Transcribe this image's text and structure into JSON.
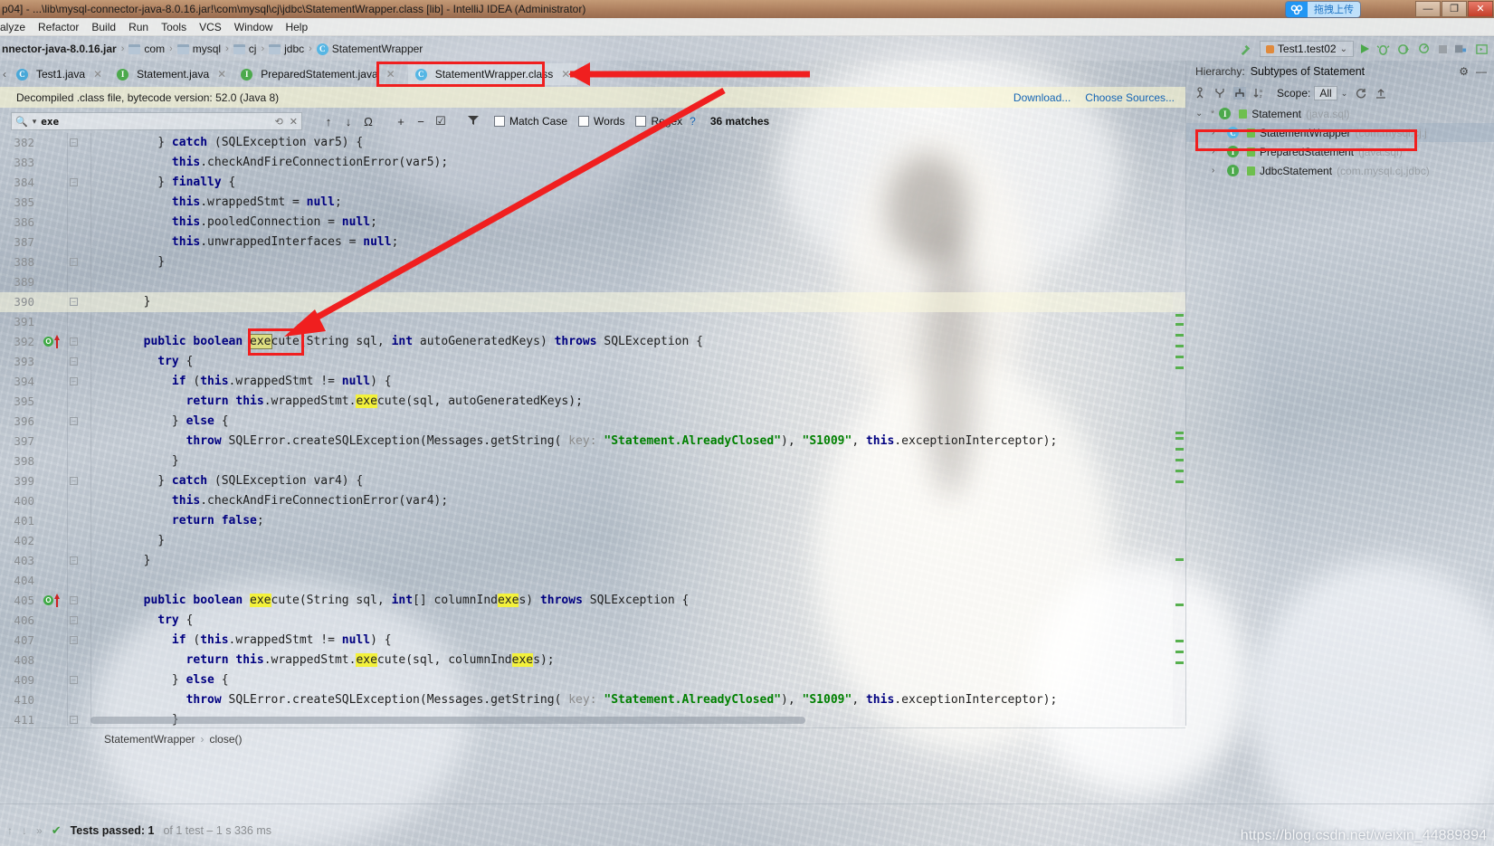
{
  "titlebar": {
    "text": "p04] - ...\\lib\\mysql-connector-java-8.0.16.jar!\\com\\mysql\\cj\\jdbc\\StatementWrapper.class [lib] - IntelliJ IDEA (Administrator)",
    "netdisk_label": "拖拽上传",
    "minimize": "—",
    "restore": "❐",
    "close": "✕"
  },
  "menubar": {
    "items": [
      "alyze",
      "Refactor",
      "Build",
      "Run",
      "Tools",
      "VCS",
      "Window",
      "Help"
    ]
  },
  "navbar": {
    "crumbs": [
      {
        "label": "nnector-java-8.0.16.jar",
        "icon": "jar-icon"
      },
      {
        "label": "com",
        "icon": "folder-icon"
      },
      {
        "label": "mysql",
        "icon": "folder-icon"
      },
      {
        "label": "cj",
        "icon": "folder-icon"
      },
      {
        "label": "jdbc",
        "icon": "folder-icon"
      },
      {
        "label": "StatementWrapper",
        "icon": "class-icon"
      }
    ],
    "separator": "›"
  },
  "runbar": {
    "config_name": "Test1.test02",
    "dropdown_caret": "⌄",
    "buttons": [
      "run-button",
      "debug-button",
      "run-with-coverage-button",
      "profile-button",
      "stop-button",
      "build-button",
      "more-button"
    ]
  },
  "tabs": [
    {
      "label": "Test1.java",
      "icon": "java-class-icon",
      "active": false,
      "close": "✕"
    },
    {
      "label": "Statement.java",
      "icon": "interface-icon",
      "active": false,
      "close": "✕"
    },
    {
      "label": "PreparedStatement.java",
      "icon": "interface-icon",
      "active": false,
      "close": "✕"
    },
    {
      "label": "StatementWrapper.class",
      "icon": "class-icon",
      "active": true,
      "close": "✕"
    }
  ],
  "notice": {
    "text": "Decompiled .class file, bytecode version: 52.0 (Java 8)",
    "download_link": "Download...",
    "choose_sources_link": "Choose Sources..."
  },
  "findbar": {
    "query_icon": "search-icon",
    "query": "exe",
    "history_caret": "▾",
    "reset_icon": "⟲",
    "clear_icon": "✕",
    "prev_icon": "↑",
    "next_icon": "↓",
    "loop_icon": "Ω",
    "add_line_icon": "+",
    "remove_line_icon": "−",
    "select_all_icon": "☑",
    "filter_icon": "filter-icon",
    "match_case": "Match Case",
    "match_case_checked": false,
    "words": "Words",
    "words_checked": false,
    "regex": "Regex",
    "regex_checked": false,
    "help": "?",
    "matches": "36 matches"
  },
  "editor": {
    "first_line": 382,
    "highlight_term": "exe",
    "lines": [
      {
        "n": 382,
        "fold": true,
        "indent": 10,
        "tokens": [
          {
            "t": "} ",
            "c": ""
          },
          {
            "t": "catch ",
            "c": "kw"
          },
          {
            "t": "(SQLException var5) {",
            "c": ""
          }
        ]
      },
      {
        "n": 383,
        "indent": 12,
        "tokens": [
          {
            "t": "this",
            "c": "kw"
          },
          {
            "t": ".checkAndFireConnectionError(var5);",
            "c": ""
          }
        ]
      },
      {
        "n": 384,
        "fold": true,
        "indent": 10,
        "tokens": [
          {
            "t": "} ",
            "c": ""
          },
          {
            "t": "finally",
            "c": "kw"
          },
          {
            "t": " {",
            "c": ""
          }
        ]
      },
      {
        "n": 385,
        "indent": 12,
        "tokens": [
          {
            "t": "this",
            "c": "kw"
          },
          {
            "t": ".wrappedStmt = ",
            "c": ""
          },
          {
            "t": "null",
            "c": "kw"
          },
          {
            "t": ";",
            "c": ""
          }
        ]
      },
      {
        "n": 386,
        "indent": 12,
        "tokens": [
          {
            "t": "this",
            "c": "kw"
          },
          {
            "t": ".pooledConnection = ",
            "c": ""
          },
          {
            "t": "null",
            "c": "kw"
          },
          {
            "t": ";",
            "c": ""
          }
        ]
      },
      {
        "n": 387,
        "indent": 12,
        "tokens": [
          {
            "t": "this",
            "c": "kw"
          },
          {
            "t": ".unwrappedInterfaces = ",
            "c": ""
          },
          {
            "t": "null",
            "c": "kw"
          },
          {
            "t": ";",
            "c": ""
          }
        ]
      },
      {
        "n": 388,
        "fold": true,
        "indent": 10,
        "tokens": [
          {
            "t": "}",
            "c": ""
          }
        ]
      },
      {
        "n": 389,
        "indent": 0,
        "tokens": []
      },
      {
        "n": 390,
        "fold": true,
        "current": true,
        "indent": 8,
        "tokens": [
          {
            "t": "}",
            "c": ""
          }
        ]
      },
      {
        "n": 391,
        "indent": 0,
        "tokens": []
      },
      {
        "n": 392,
        "fold": true,
        "gutter_mark": "overridden",
        "indent": 8,
        "tokens": [
          {
            "t": "public boolean ",
            "c": "kw"
          },
          {
            "t": "exe",
            "c": "hlbox"
          },
          {
            "t": "cute",
            "c": ""
          },
          {
            "t": "(String sql, ",
            "c": ""
          },
          {
            "t": "int",
            "c": "kw"
          },
          {
            "t": " autoGeneratedKeys) ",
            "c": ""
          },
          {
            "t": "throws",
            "c": "kw"
          },
          {
            "t": " SQLException {",
            "c": ""
          }
        ]
      },
      {
        "n": 393,
        "fold": true,
        "indent": 10,
        "tokens": [
          {
            "t": "try",
            "c": "kw"
          },
          {
            "t": " {",
            "c": ""
          }
        ]
      },
      {
        "n": 394,
        "fold": true,
        "indent": 12,
        "tokens": [
          {
            "t": "if",
            "c": "kw"
          },
          {
            "t": " (",
            "c": ""
          },
          {
            "t": "this",
            "c": "kw"
          },
          {
            "t": ".wrappedStmt != ",
            "c": ""
          },
          {
            "t": "null",
            "c": "kw"
          },
          {
            "t": ") {",
            "c": ""
          }
        ]
      },
      {
        "n": 395,
        "indent": 14,
        "tokens": [
          {
            "t": "return ",
            "c": "kw"
          },
          {
            "t": "this",
            "c": "kw"
          },
          {
            "t": ".wrappedStmt.",
            "c": ""
          },
          {
            "t": "exe",
            "c": "hl"
          },
          {
            "t": "cute(sql, autoGeneratedKeys);",
            "c": ""
          }
        ]
      },
      {
        "n": 396,
        "fold": true,
        "indent": 12,
        "tokens": [
          {
            "t": "} ",
            "c": ""
          },
          {
            "t": "else",
            "c": "kw"
          },
          {
            "t": " {",
            "c": ""
          }
        ]
      },
      {
        "n": 397,
        "indent": 14,
        "tokens": [
          {
            "t": "throw",
            "c": "kw"
          },
          {
            "t": " SQLError.createSQLException(Messages.getString(",
            "c": ""
          },
          {
            "t": " key:",
            "c": "hint"
          },
          {
            "t": " ",
            "c": ""
          },
          {
            "t": "\"Statement.AlreadyClosed\"",
            "c": "str"
          },
          {
            "t": "), ",
            "c": ""
          },
          {
            "t": "\"S1009\"",
            "c": "str"
          },
          {
            "t": ", ",
            "c": ""
          },
          {
            "t": "this",
            "c": "kw"
          },
          {
            "t": ".exceptionInterceptor);",
            "c": ""
          }
        ]
      },
      {
        "n": 398,
        "indent": 12,
        "tokens": [
          {
            "t": "}",
            "c": ""
          }
        ]
      },
      {
        "n": 399,
        "fold": true,
        "indent": 10,
        "tokens": [
          {
            "t": "} ",
            "c": ""
          },
          {
            "t": "catch",
            "c": "kw"
          },
          {
            "t": " (SQLException var4) {",
            "c": ""
          }
        ]
      },
      {
        "n": 400,
        "indent": 12,
        "tokens": [
          {
            "t": "this",
            "c": "kw"
          },
          {
            "t": ".checkAndFireConnectionError(var4);",
            "c": ""
          }
        ]
      },
      {
        "n": 401,
        "indent": 12,
        "tokens": [
          {
            "t": "return false",
            "c": "kw"
          },
          {
            "t": ";",
            "c": ""
          }
        ]
      },
      {
        "n": 402,
        "indent": 10,
        "tokens": [
          {
            "t": "}",
            "c": ""
          }
        ]
      },
      {
        "n": 403,
        "fold": true,
        "indent": 8,
        "tokens": [
          {
            "t": "}",
            "c": ""
          }
        ]
      },
      {
        "n": 404,
        "indent": 0,
        "tokens": []
      },
      {
        "n": 405,
        "fold": true,
        "gutter_mark": "overridden",
        "indent": 8,
        "tokens": [
          {
            "t": "public boolean ",
            "c": "kw"
          },
          {
            "t": "exe",
            "c": "hl"
          },
          {
            "t": "cute(String sql, ",
            "c": ""
          },
          {
            "t": "int",
            "c": "kw"
          },
          {
            "t": "[] columnInd",
            "c": ""
          },
          {
            "t": "exe",
            "c": "hl"
          },
          {
            "t": "s) ",
            "c": ""
          },
          {
            "t": "throws",
            "c": "kw"
          },
          {
            "t": " SQLException {",
            "c": ""
          }
        ]
      },
      {
        "n": 406,
        "fold": true,
        "indent": 10,
        "tokens": [
          {
            "t": "try",
            "c": "kw"
          },
          {
            "t": " {",
            "c": ""
          }
        ]
      },
      {
        "n": 407,
        "fold": true,
        "indent": 12,
        "tokens": [
          {
            "t": "if",
            "c": "kw"
          },
          {
            "t": " (",
            "c": ""
          },
          {
            "t": "this",
            "c": "kw"
          },
          {
            "t": ".wrappedStmt != ",
            "c": ""
          },
          {
            "t": "null",
            "c": "kw"
          },
          {
            "t": ") {",
            "c": ""
          }
        ]
      },
      {
        "n": 408,
        "indent": 14,
        "tokens": [
          {
            "t": "return ",
            "c": "kw"
          },
          {
            "t": "this",
            "c": "kw"
          },
          {
            "t": ".wrappedStmt.",
            "c": ""
          },
          {
            "t": "exe",
            "c": "hl"
          },
          {
            "t": "cute(sql, columnInd",
            "c": ""
          },
          {
            "t": "exe",
            "c": "hl"
          },
          {
            "t": "s);",
            "c": ""
          }
        ]
      },
      {
        "n": 409,
        "fold": true,
        "indent": 12,
        "tokens": [
          {
            "t": "} ",
            "c": ""
          },
          {
            "t": "else",
            "c": "kw"
          },
          {
            "t": " {",
            "c": ""
          }
        ]
      },
      {
        "n": 410,
        "indent": 14,
        "tokens": [
          {
            "t": "throw",
            "c": "kw"
          },
          {
            "t": " SQLError.createSQLException(Messages.getString(",
            "c": ""
          },
          {
            "t": " key:",
            "c": "hint"
          },
          {
            "t": " ",
            "c": ""
          },
          {
            "t": "\"Statement.AlreadyClosed\"",
            "c": "str"
          },
          {
            "t": "), ",
            "c": ""
          },
          {
            "t": "\"S1009\"",
            "c": "str"
          },
          {
            "t": ", ",
            "c": ""
          },
          {
            "t": "this",
            "c": "kw"
          },
          {
            "t": ".exceptionInterceptor);",
            "c": ""
          }
        ]
      },
      {
        "n": 411,
        "fold": true,
        "indent": 12,
        "tokens": [
          {
            "t": "}",
            "c": ""
          }
        ]
      }
    ]
  },
  "editor_breadcrumb": {
    "items": [
      "StatementWrapper",
      "close()"
    ],
    "separator": "›"
  },
  "hierarchy": {
    "title_prefix": "Hierarchy:",
    "title": "Subtypes of Statement",
    "settings_icon": "gear-icon",
    "hide_icon": "—",
    "toolbar": {
      "type_hierarchy_icon": "type-hierarchy-icon",
      "supertypes_icon": "supertypes-icon",
      "subtypes_icon": "subtypes-icon",
      "sort_icon": "sort-alpha-icon",
      "scope_label": "Scope:",
      "scope_value": "All",
      "scope_caret": "⌄",
      "refresh_icon": "refresh-icon",
      "export_icon": "export-icon"
    },
    "nodes": [
      {
        "depth": 0,
        "twisty": "⌄",
        "star": "*",
        "icon": "interface-icon",
        "name": "Statement",
        "pkg": "(java.sql)",
        "selected": false
      },
      {
        "depth": 1,
        "twisty": "›",
        "icon": "class-icon",
        "name": "StatementWrapper",
        "pkg": "(com.mysql.cj.j",
        "selected": true
      },
      {
        "depth": 1,
        "twisty": "›",
        "icon": "interface-icon",
        "name": "PreparedStatement",
        "pkg": "(java.sql)",
        "selected": false
      },
      {
        "depth": 1,
        "twisty": "›",
        "icon": "interface-icon",
        "name": "JdbcStatement",
        "pkg": "(com.mysql.cj.jdbc)",
        "selected": false
      }
    ]
  },
  "bottombar": {
    "up_icon": "↑",
    "down_icon": "↓",
    "expand_icon": "»",
    "check_icon": "✔",
    "status_bold": "Tests passed: 1",
    "status_rest": "of 1 test – 1 s 336 ms"
  },
  "watermark": "https://blog.csdn.net/weixin_44889894",
  "colors": {
    "accent_red": "#f01f1f",
    "keyword_blue": "#000080",
    "string_green": "#008000",
    "highlight_yellow": "#f3f13c",
    "link_blue": "#1464b4",
    "title_brown": "#ab7854",
    "netdisk_blue": "#2196f3",
    "pass_green": "#3f9e3f"
  }
}
